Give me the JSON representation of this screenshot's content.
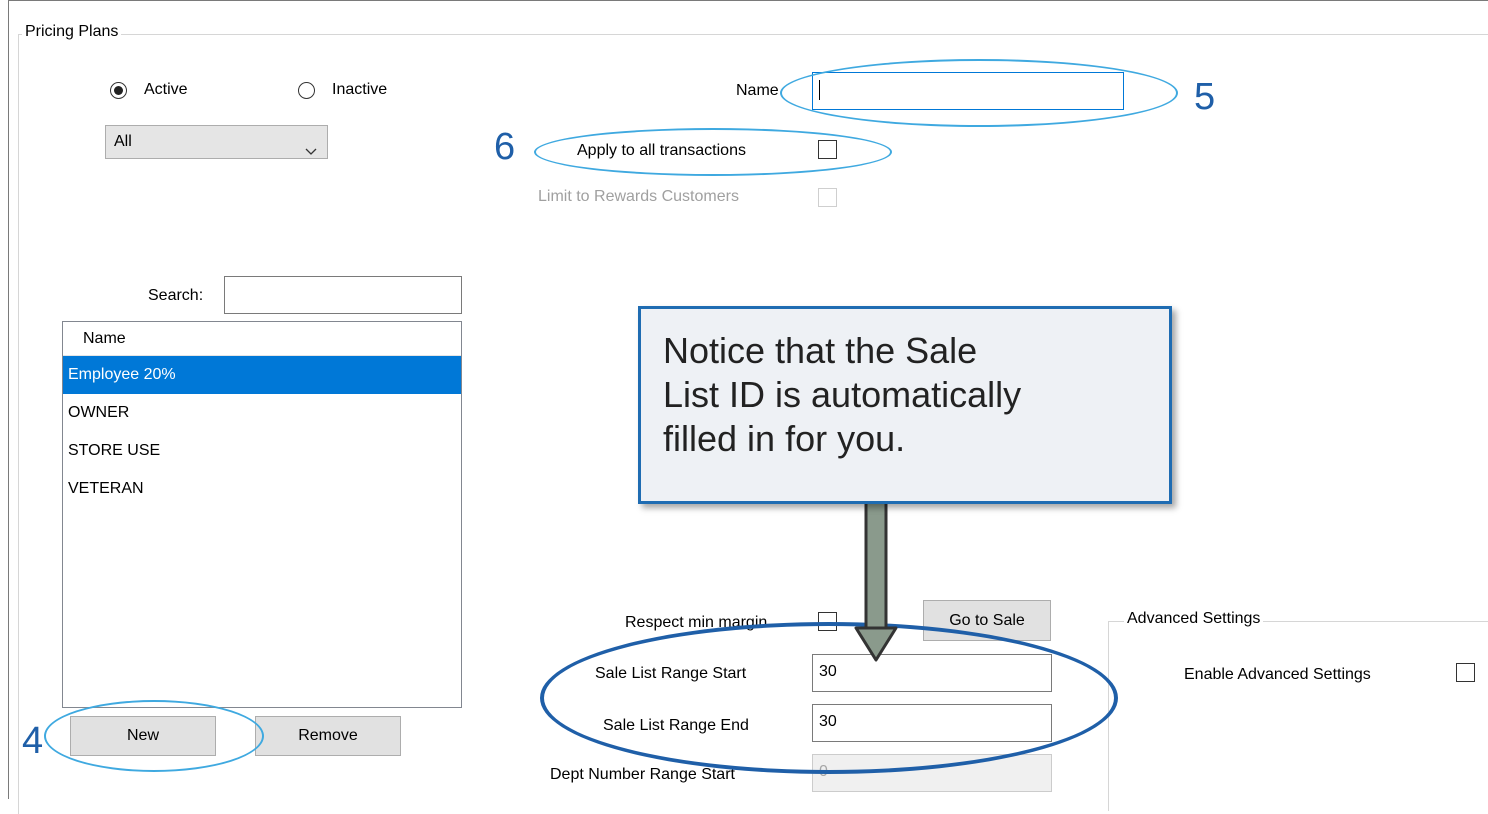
{
  "window": {
    "group_title": "Pricing Plans",
    "border_color": "#7a7a7a"
  },
  "status_filter": {
    "active_label": "Active",
    "inactive_label": "Inactive",
    "selected": "Active",
    "category_value": "All"
  },
  "form": {
    "name_label": "Name",
    "name_value": "",
    "apply_all_label": "Apply to all transactions",
    "apply_all_checked": false,
    "limit_rewards_label": "Limit to Rewards Customers",
    "limit_rewards_checked": false,
    "respect_margin_label": "Respect min margin",
    "respect_margin_checked": false,
    "go_to_sale_label": "Go to Sale",
    "range_start_label": "Sale List Range Start",
    "range_start_value": "30",
    "range_end_label": "Sale List Range End",
    "range_end_value": "30",
    "dept_start_label": "Dept Number Range Start",
    "dept_start_value": "0"
  },
  "search": {
    "label": "Search:",
    "value": ""
  },
  "plans_list": {
    "header": "Name",
    "items": [
      "Employee 20%",
      "OWNER",
      "STORE USE",
      "VETERAN"
    ],
    "selected_index": 0
  },
  "list_buttons": {
    "new_label": "New",
    "remove_label": "Remove"
  },
  "advanced": {
    "group_title": "Advanced Settings",
    "enable_label": "Enable Advanced Settings",
    "enable_checked": false
  },
  "annotations": {
    "step_4": "4",
    "step_5": "5",
    "step_6": "6",
    "callout_line1": "Notice that the Sale",
    "callout_line2": "List ID is automatically",
    "callout_line3": "filled in for you.",
    "accent_light": "#3fa9e0",
    "accent_dark": "#1f5fa8",
    "selection_color": "#0078d7"
  }
}
